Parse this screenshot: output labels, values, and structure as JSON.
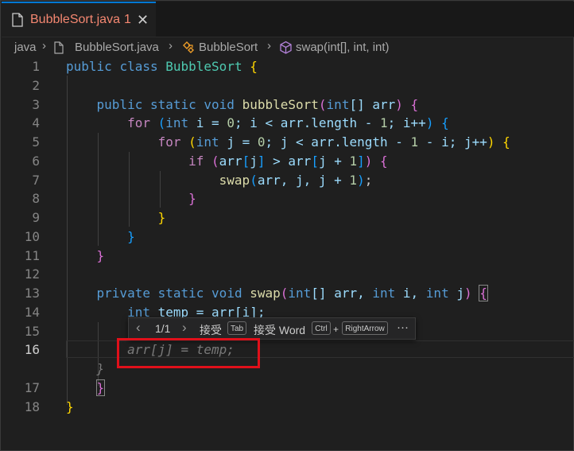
{
  "tab": {
    "title": "BubbleSort.java",
    "problem_count": "1",
    "close_glyph": "✕",
    "icon": "java-file-icon"
  },
  "breadcrumb": {
    "items": [
      "java",
      "BubbleSort.java",
      "BubbleSort",
      "swap(int[], int, int)"
    ],
    "separator": "›"
  },
  "line_numbers": [
    "1",
    "2",
    "3",
    "4",
    "5",
    "6",
    "7",
    "8",
    "9",
    "10",
    "11",
    "12",
    "13",
    "14",
    "15",
    "16",
    "17",
    "18"
  ],
  "active_line": "16",
  "code": {
    "l1_kw1": "public",
    "l1_kw2": "class",
    "l1_name": "BubbleSort",
    "l1_brace": "{",
    "l3_kw1": "public",
    "l3_kw2": "static",
    "l3_kw3": "void",
    "l3_fn": "bubbleSort",
    "l3_p1": "(",
    "l3_type": "int",
    "l3_arr": "[] arr",
    "l3_p2": ")",
    "l3_brace": "{",
    "l4_for": "for",
    "l4_open": "(",
    "l4_int": "int",
    "l4_rest1": " i = ",
    "l4_zero": "0",
    "l4_rest2": "; i < arr.length - ",
    "l4_one": "1",
    "l4_rest3": "; i++",
    "l4_close": ")",
    "l4_brace": "{",
    "l5_for": "for",
    "l5_open": "(",
    "l5_int": "int",
    "l5_rest1": " j = ",
    "l5_zero": "0",
    "l5_rest2": "; j < arr.length - ",
    "l5_one": "1",
    "l5_rest3": " - i; j++",
    "l5_close": ")",
    "l5_brace": "{",
    "l6_if": "if",
    "l6_open": "(",
    "l6_arr1": "arr",
    "l6_b1": "[",
    "l6_j1": "j",
    "l6_b2": "]",
    "l6_gt": " > ",
    "l6_arr2": "arr",
    "l6_b3": "[",
    "l6_j2": "j + ",
    "l6_one": "1",
    "l6_b4": "]",
    "l6_close": ")",
    "l6_brace": "{",
    "l7_fn": "swap",
    "l7_open": "(",
    "l7_args1": "arr, j, j + ",
    "l7_one": "1",
    "l7_close": ")",
    "l7_semi": ";",
    "l8_brace": "}",
    "l9_brace": "}",
    "l10_brace": "}",
    "l11_brace": "}",
    "l13_kw1": "private",
    "l13_kw2": "static",
    "l13_kw3": "void",
    "l13_fn": "swap",
    "l13_open": "(",
    "l13_int1": "int",
    "l13_arr": "[] arr, ",
    "l13_int2": "int",
    "l13_i": " i, ",
    "l13_int3": "int",
    "l13_j": " j",
    "l13_close": ")",
    "l13_brace": "{",
    "l14_int": "int",
    "l14_rest": " temp = arr[i];",
    "l16_ghost": "arr[j] = temp;",
    "l16b_ghost": "}",
    "l17_brace": "}",
    "l18_brace": "}"
  },
  "suggestion_bar": {
    "prev_glyph": "‹",
    "counter": "1/1",
    "next_glyph": "›",
    "accept_label": "接受",
    "accept_key": "Tab",
    "accept_word_label": "接受 Word",
    "key_ctrl": "Ctrl",
    "plus": "+",
    "key_right": "RightArrow",
    "more_glyph": "···"
  },
  "colors": {
    "accent": "#0078d4",
    "error_text": "#f48771",
    "highlight": "#e0101a"
  }
}
